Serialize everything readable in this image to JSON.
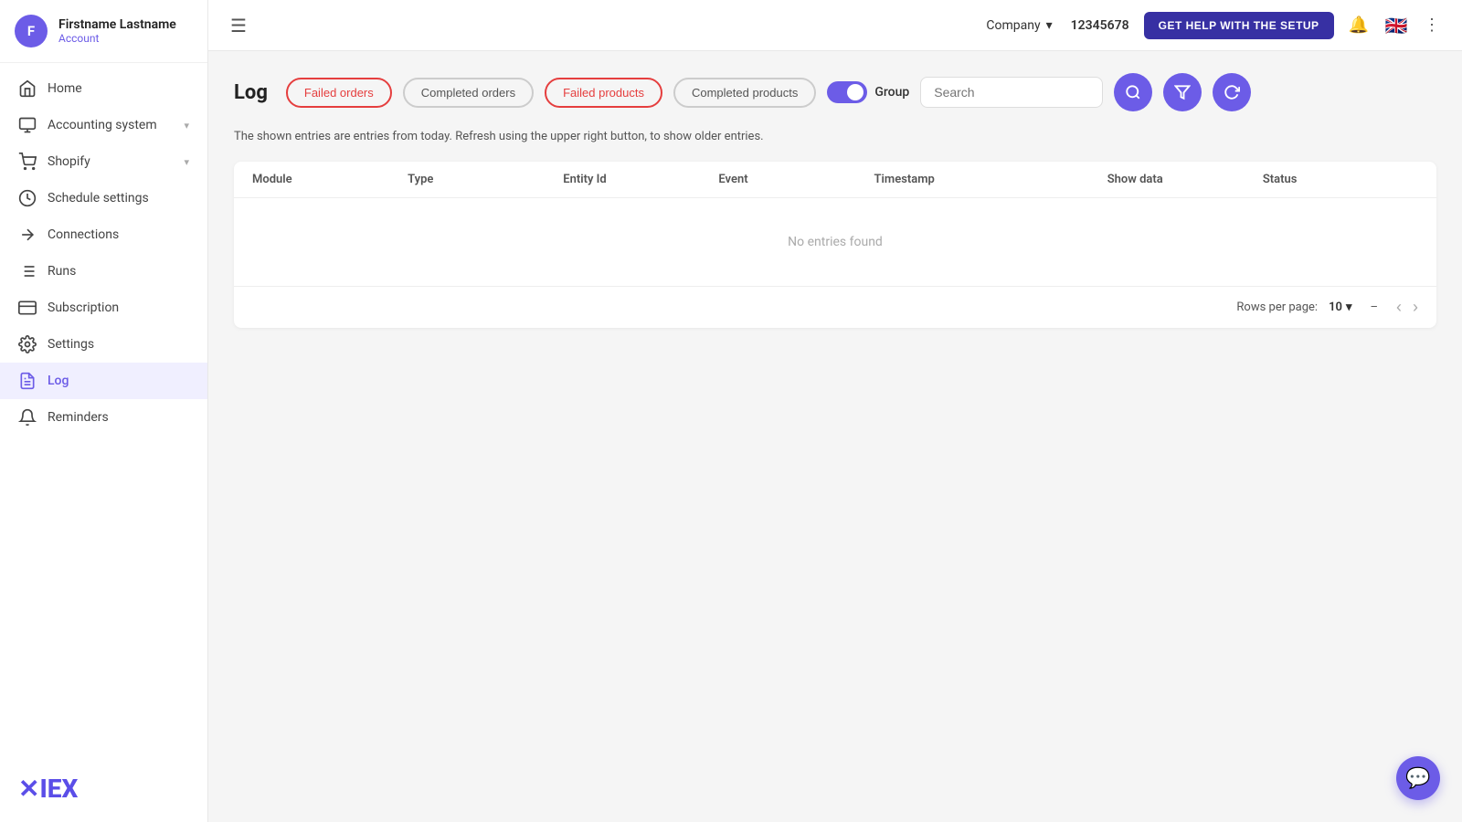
{
  "user": {
    "initial": "F",
    "name": "Firstname Lastname",
    "account_label": "Account"
  },
  "sidebar": {
    "items": [
      {
        "id": "home",
        "label": "Home",
        "icon": "home"
      },
      {
        "id": "accounting",
        "label": "Accounting system",
        "icon": "accounting",
        "hasChevron": true
      },
      {
        "id": "shopify",
        "label": "Shopify",
        "icon": "shopify",
        "hasChevron": true
      },
      {
        "id": "schedule",
        "label": "Schedule settings",
        "icon": "schedule"
      },
      {
        "id": "connections",
        "label": "Connections",
        "icon": "connections"
      },
      {
        "id": "runs",
        "label": "Runs",
        "icon": "runs"
      },
      {
        "id": "subscription",
        "label": "Subscription",
        "icon": "subscription"
      },
      {
        "id": "settings",
        "label": "Settings",
        "icon": "settings"
      },
      {
        "id": "log",
        "label": "Log",
        "icon": "log",
        "active": true
      },
      {
        "id": "reminders",
        "label": "Reminders",
        "icon": "reminders"
      }
    ]
  },
  "topbar": {
    "company_label": "Company",
    "company_id": "12345678",
    "help_button": "GET HELP WITH THE SETUP"
  },
  "log_page": {
    "title": "Log",
    "filters": [
      {
        "id": "failed-orders",
        "label": "Failed orders",
        "style": "active-red"
      },
      {
        "id": "completed-orders",
        "label": "Completed orders",
        "style": "inactive"
      },
      {
        "id": "failed-products",
        "label": "Failed products",
        "style": "active-red"
      },
      {
        "id": "completed-products",
        "label": "Completed products",
        "style": "inactive"
      }
    ],
    "group_label": "Group",
    "group_enabled": true,
    "search_placeholder": "Search",
    "info_text": "The shown entries are entries from today. Refresh using the upper right button, to show older entries.",
    "table": {
      "columns": [
        "Module",
        "Type",
        "Entity Id",
        "Event",
        "Timestamp",
        "Show data",
        "Status"
      ],
      "empty_text": "No entries found"
    },
    "pagination": {
      "rows_per_page_label": "Rows per page:",
      "rows_per_page_value": "10",
      "page_range": "–"
    }
  }
}
